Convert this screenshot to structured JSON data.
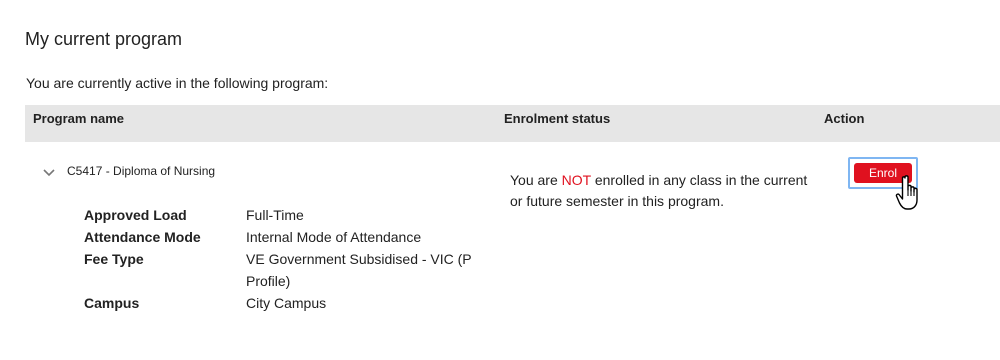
{
  "page": {
    "title": "My current program",
    "intro": "You are currently active in the following program:"
  },
  "table": {
    "headers": {
      "program_name": "Program name",
      "enrolment_status": "Enrolment status",
      "action": "Action"
    },
    "row": {
      "program": "C5417 - Diploma of Nursing",
      "details": [
        {
          "label": "Approved Load",
          "value": "Full-Time"
        },
        {
          "label": "Attendance Mode",
          "value": "Internal Mode of Attendance"
        },
        {
          "label": "Fee Type",
          "value": "VE Government Subsidised - VIC (P Profile)"
        },
        {
          "label": "Campus",
          "value": "City Campus"
        }
      ],
      "status": {
        "prefix": "You are ",
        "emphasis": "NOT",
        "suffix": " enrolled in any class in the current or future semester in this program."
      },
      "action_label": "Enrol"
    }
  },
  "colors": {
    "accent_red": "#e0111f",
    "header_bg": "#e6e6e6",
    "focus_ring": "#7fb6f2"
  },
  "icons": {
    "expand": "chevron-down-icon",
    "pointer": "hand-pointer-cursor-icon"
  }
}
